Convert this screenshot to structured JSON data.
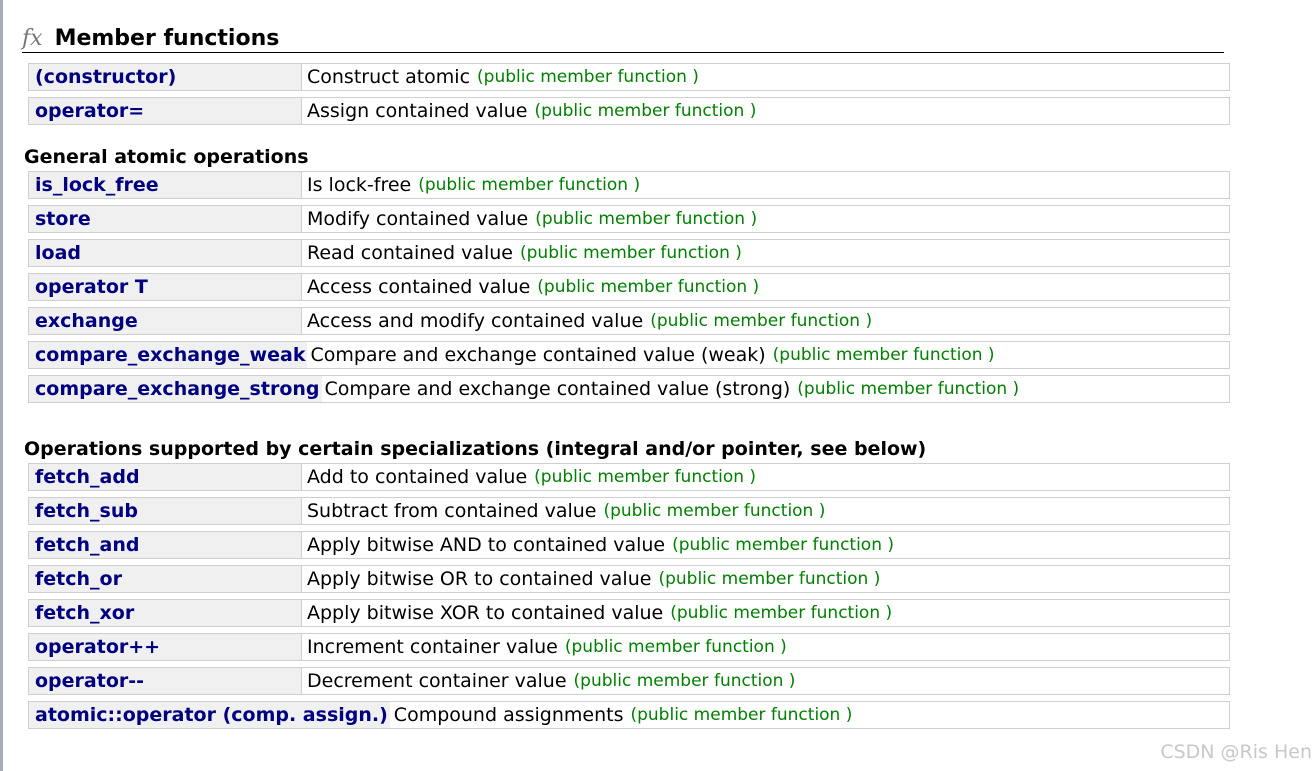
{
  "section": {
    "icon": "fx-icon",
    "icon_text": "fx",
    "title": "Member functions"
  },
  "colors": {
    "name": "#000080",
    "kind": "#008000",
    "name_cell_bg": "#f0f0f0",
    "border": "#cfcfcf"
  },
  "groups": [
    {
      "title": "",
      "rows": [
        {
          "name": "(constructor)",
          "desc": "Construct atomic",
          "kind": "(public member function )"
        },
        {
          "name": "operator=",
          "desc": "Assign contained value",
          "kind": "(public member function )"
        }
      ]
    },
    {
      "title": "General atomic operations",
      "rows": [
        {
          "name": "is_lock_free",
          "desc": "Is lock-free",
          "kind": "(public member function )"
        },
        {
          "name": "store",
          "desc": "Modify contained value",
          "kind": "(public member function )"
        },
        {
          "name": "load",
          "desc": "Read contained value",
          "kind": "(public member function )"
        },
        {
          "name": "operator T",
          "desc": "Access contained value",
          "kind": "(public member function )"
        },
        {
          "name": "exchange",
          "desc": "Access and modify contained value",
          "kind": "(public member function )"
        },
        {
          "name": "compare_exchange_weak",
          "desc": "Compare and exchange contained value (weak)",
          "kind": "(public member function )"
        },
        {
          "name": "compare_exchange_strong",
          "desc": "Compare and exchange contained value (strong)",
          "kind": "(public member function )"
        }
      ]
    },
    {
      "title": "Operations supported by certain specializations (integral and/or pointer, see below)",
      "rows": [
        {
          "name": "fetch_add",
          "desc": "Add to contained value",
          "kind": "(public member function )"
        },
        {
          "name": "fetch_sub",
          "desc": "Subtract from contained value",
          "kind": "(public member function )"
        },
        {
          "name": "fetch_and",
          "desc": "Apply bitwise AND to contained value",
          "kind": "(public member function )"
        },
        {
          "name": "fetch_or",
          "desc": "Apply bitwise OR to contained value",
          "kind": "(public member function )"
        },
        {
          "name": "fetch_xor",
          "desc": "Apply bitwise XOR to contained value",
          "kind": "(public member function )"
        },
        {
          "name": "operator++",
          "desc": "Increment container value",
          "kind": "(public member function )"
        },
        {
          "name": "operator--",
          "desc": "Decrement container value",
          "kind": "(public member function )"
        },
        {
          "name": "atomic::operator (comp. assign.)",
          "desc": "Compound assignments",
          "kind": "(public member function )"
        }
      ]
    }
  ],
  "watermark": "CSDN @Ris Hen"
}
